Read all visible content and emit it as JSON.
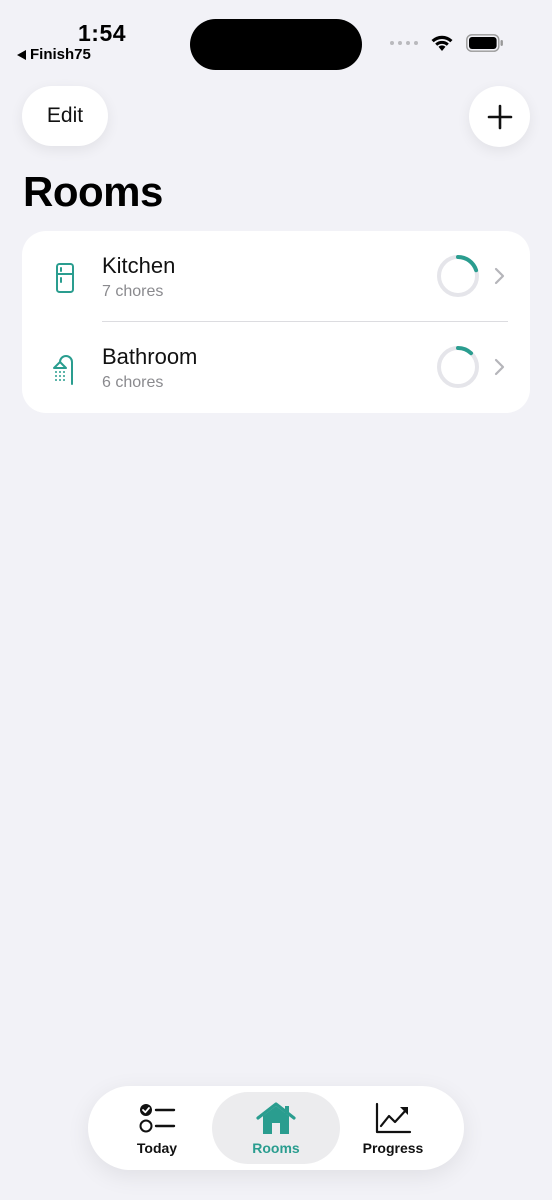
{
  "status_bar": {
    "time": "1:54",
    "back_app": "Finish75"
  },
  "toolbar": {
    "edit_label": "Edit",
    "add_icon": "plus-icon"
  },
  "title": "Rooms",
  "colors": {
    "accent": "#2a9d8f",
    "background": "#f2f2f7",
    "ring_track": "#e5e5ea"
  },
  "rooms": [
    {
      "name": "Kitchen",
      "subtitle": "7 chores",
      "icon": "fridge-icon",
      "progress": 0.2
    },
    {
      "name": "Bathroom",
      "subtitle": "6 chores",
      "icon": "shower-icon",
      "progress": 0.12
    }
  ],
  "tabs": [
    {
      "label": "Today",
      "icon": "checklist-icon",
      "selected": false
    },
    {
      "label": "Rooms",
      "icon": "house-icon",
      "selected": true
    },
    {
      "label": "Progress",
      "icon": "chart-icon",
      "selected": false
    }
  ]
}
